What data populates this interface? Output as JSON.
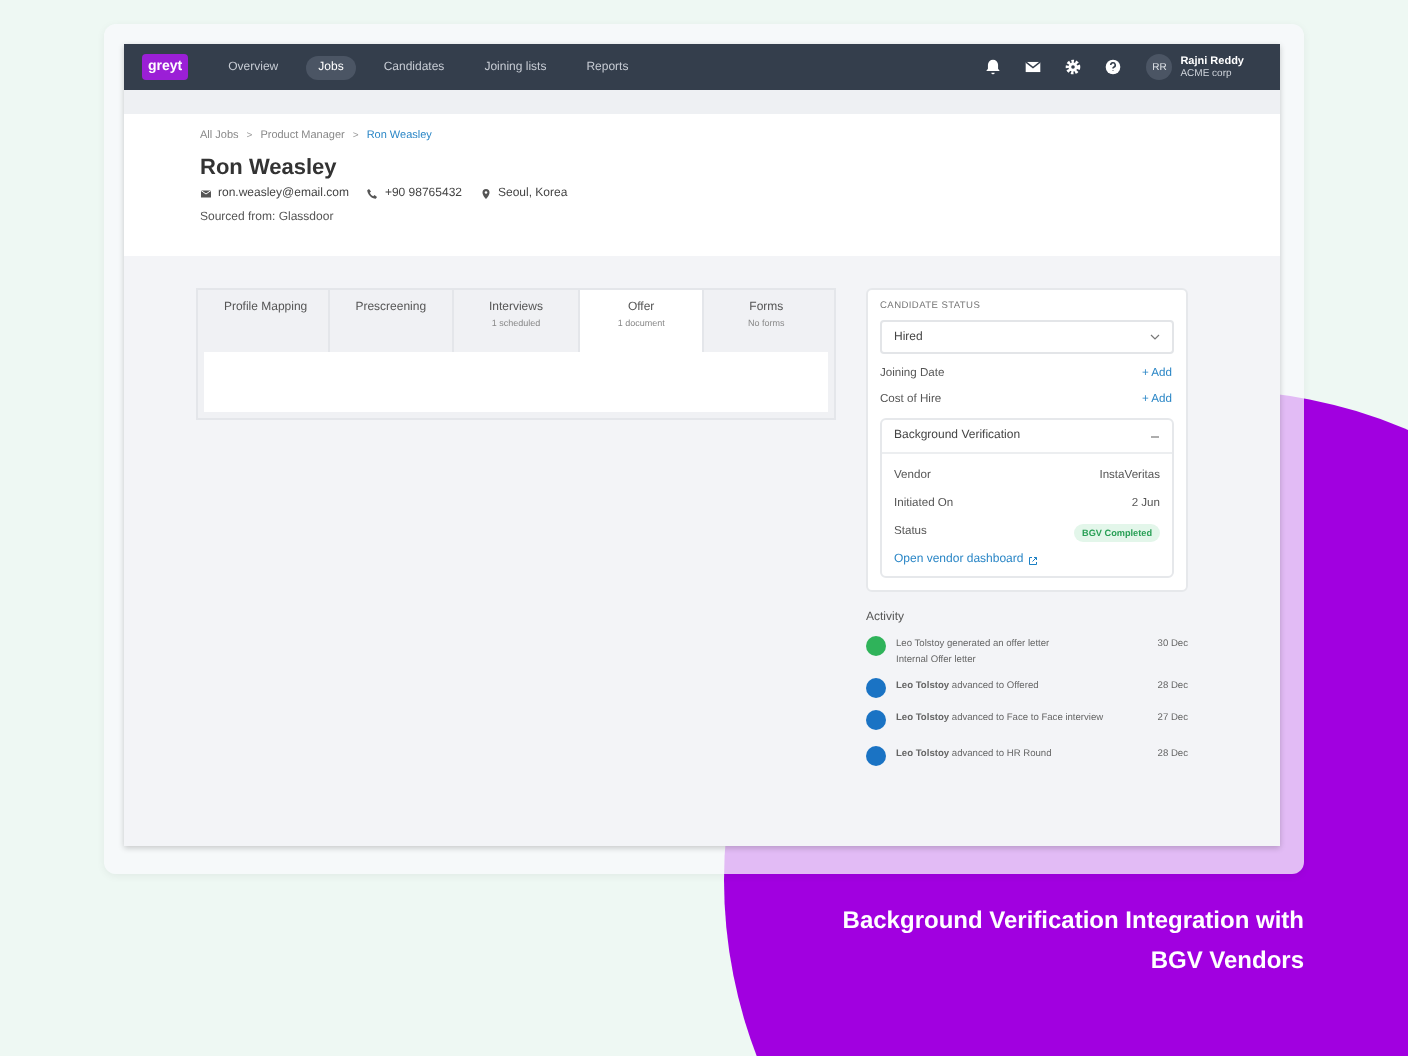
{
  "nav": {
    "logo": "greyt",
    "items": [
      {
        "label": "Overview",
        "selected": false
      },
      {
        "label": "Jobs",
        "selected": true
      },
      {
        "label": "Candidates",
        "selected": false
      },
      {
        "label": "Joining lists",
        "selected": false
      },
      {
        "label": "Reports",
        "selected": false
      }
    ],
    "user": {
      "initials": "RR",
      "name": "Rajni Reddy",
      "company": "ACME corp"
    }
  },
  "breadcrumb": [
    {
      "label": "All Jobs",
      "current": false
    },
    {
      "label": "Product Manager",
      "current": false
    },
    {
      "label": "Ron Weasley",
      "current": true
    }
  ],
  "breadcrumb_separator": ">",
  "candidate": {
    "name": "Ron Weasley",
    "email": "ron.weasley@email.com",
    "phone": "+90 98765432",
    "location": "Seoul, Korea",
    "source": "Sourced from: Glassdoor"
  },
  "tabs": [
    {
      "label": "Profile Mapping",
      "selected": false
    },
    {
      "label": "Prescreening",
      "selected": false
    },
    {
      "label": "Interviews",
      "sub": "1 scheduled",
      "selected": false
    },
    {
      "label": "Offer",
      "sub": "1 document",
      "selected": true
    },
    {
      "label": "Forms",
      "sub": "No forms",
      "selected": false
    }
  ],
  "status_panel": {
    "heading": "CANDIDATE STATUS",
    "status": "Hired",
    "fields": [
      {
        "label": "Joining Date",
        "action": "+ Add"
      },
      {
        "label": "Cost of Hire",
        "action": "+ Add"
      }
    ],
    "bgv": {
      "title": "Background Verification",
      "expanded": true,
      "rows": [
        {
          "label": "Vendor",
          "value": "InstaVeritas",
          "kind": "text"
        },
        {
          "label": "Initiated On",
          "value": "2 Jun",
          "kind": "text"
        },
        {
          "label": "Status",
          "value": "BGV Completed",
          "kind": "badge"
        }
      ],
      "link": "Open vendor dashboard"
    }
  },
  "activity": {
    "heading": "Activity",
    "items": [
      {
        "text": "Leo Tolstoy generated an offer letter",
        "detail": "Internal Offer letter",
        "date": "30 Dec",
        "color": "#2fb35a"
      },
      {
        "text": "**Leo Tolstoy** advanced to Offered",
        "date": "28 Dec",
        "color": "#1a73c4"
      },
      {
        "text": "**Leo Tolstoy** advanced to Face to Face interview",
        "date": "27 Dec",
        "color": "#1a73c4"
      },
      {
        "text": "**Leo Tolstoy** advanced to HR Round",
        "date": "28 Dec",
        "color": "#1a73c4"
      }
    ]
  },
  "caption": [
    "Background Verification Integration with",
    "BGV Vendors"
  ]
}
